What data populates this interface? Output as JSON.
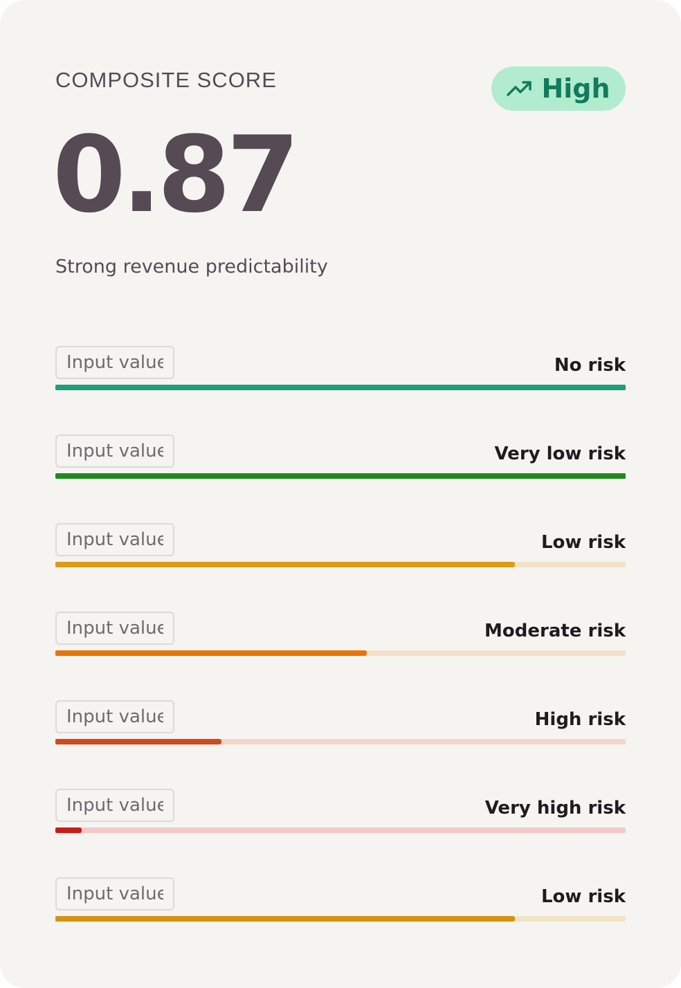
{
  "card": {
    "label": "COMPOSITE SCORE",
    "badge": {
      "icon": "trending-up-icon",
      "text": "High",
      "bg_color": "#b1ecce",
      "text_color": "#137a5d"
    },
    "score": "0.87",
    "subtitle": "Strong revenue predictability"
  },
  "rows": [
    {
      "placeholder": "Input value",
      "risk": "No risk",
      "fill": 1.0,
      "color": "#1e9e7c",
      "track_color": "#1e9e7c"
    },
    {
      "placeholder": "Input value",
      "risk": "Very low risk",
      "fill": 1.0,
      "color": "#1e8a1e",
      "track_color": "#1e8a1e"
    },
    {
      "placeholder": "Input value",
      "risk": "Low risk",
      "fill": 0.806,
      "color": "#de9b15",
      "track_color": "#f3e3c4"
    },
    {
      "placeholder": "Input value",
      "risk": "Moderate risk",
      "fill": 0.546,
      "color": "#e77507",
      "track_color": "#f4dfc8"
    },
    {
      "placeholder": "Input value",
      "risk": "High risk",
      "fill": 0.291,
      "color": "#cf4a1c",
      "track_color": "#f2d6c7"
    },
    {
      "placeholder": "Input value",
      "risk": "Very high risk",
      "fill": 0.046,
      "color": "#c81c18",
      "track_color": "#f3c9c8"
    },
    {
      "placeholder": "Input value",
      "risk": "Low risk",
      "fill": 0.806,
      "color": "#d4930f",
      "track_color": "#f2e3c8"
    }
  ]
}
